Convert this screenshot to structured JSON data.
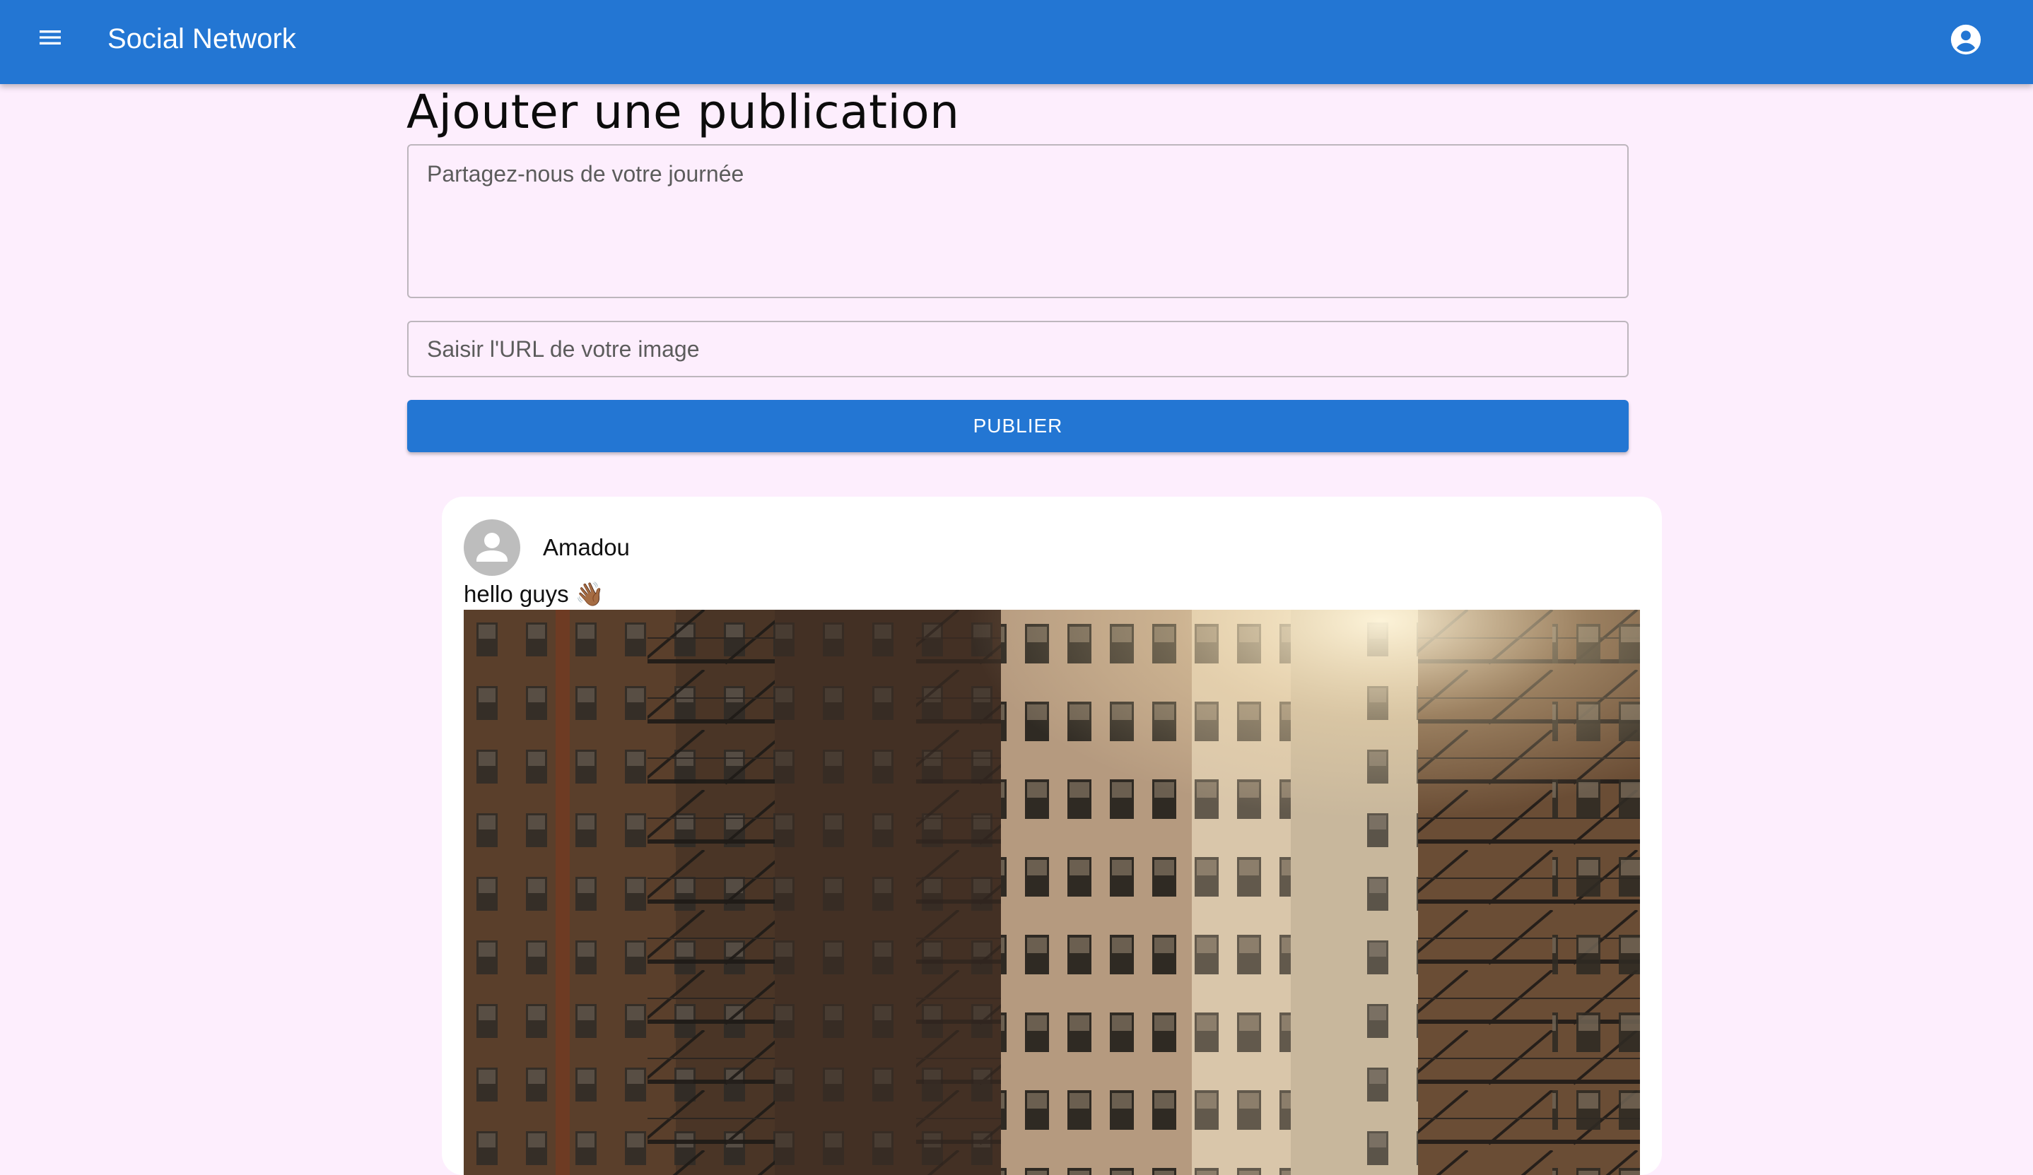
{
  "appbar": {
    "title": "Social Network",
    "menu_icon": "menu-icon",
    "account_icon": "account-circle-icon",
    "color": "#2376d3"
  },
  "composer": {
    "heading": "Ajouter une publication",
    "content_placeholder": "Partagez-nous de votre journée",
    "content_value": "",
    "image_url_placeholder": "Saisir l'URL de votre image",
    "image_url_value": "",
    "publish_label": "PUBLIER"
  },
  "posts": [
    {
      "author": "Amadou",
      "avatar_icon": "person-icon",
      "text": "hello guys 👋🏾",
      "image_description": "photo of brick apartment buildings with fire escapes"
    }
  ],
  "colors": {
    "background": "#fdeefd",
    "primary": "#2376d3",
    "card": "#ffffff"
  }
}
